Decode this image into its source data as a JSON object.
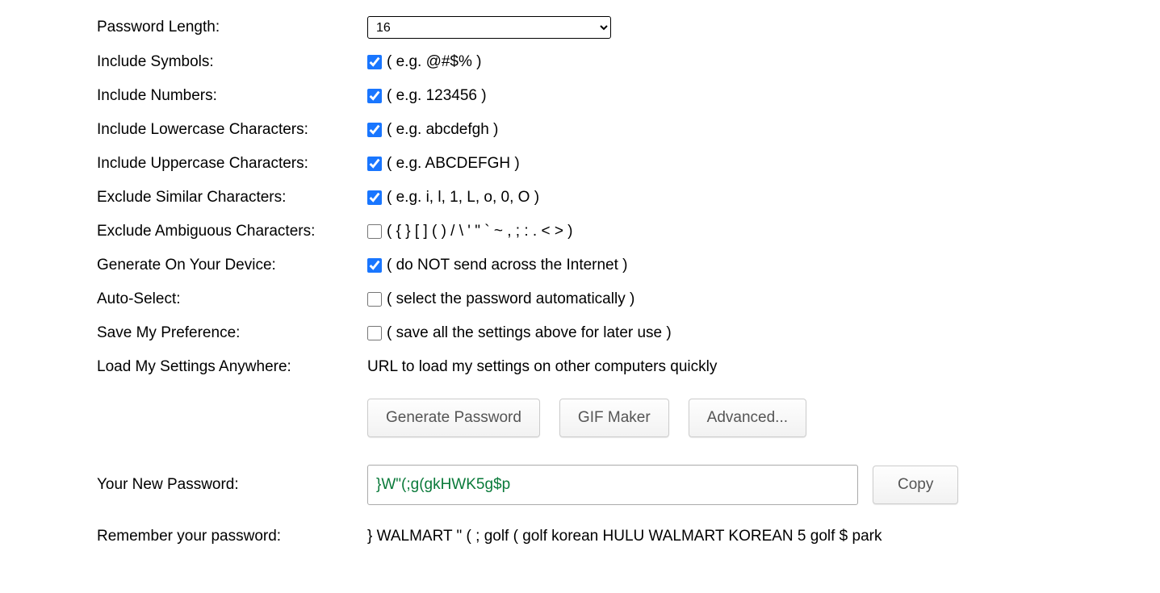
{
  "form": {
    "password_length": {
      "label": "Password Length:",
      "value": "16"
    },
    "include_symbols": {
      "label": "Include Symbols:",
      "checked": true,
      "hint": "( e.g. @#$% )"
    },
    "include_numbers": {
      "label": "Include Numbers:",
      "checked": true,
      "hint": "( e.g. 123456 )"
    },
    "include_lowercase": {
      "label": "Include Lowercase Characters:",
      "checked": true,
      "hint": "( e.g. abcdefgh )"
    },
    "include_uppercase": {
      "label": "Include Uppercase Characters:",
      "checked": true,
      "hint": "( e.g. ABCDEFGH )"
    },
    "exclude_similar": {
      "label": "Exclude Similar Characters:",
      "checked": true,
      "hint": "( e.g. i, l, 1, L, o, 0, O )"
    },
    "exclude_ambiguous": {
      "label": "Exclude Ambiguous Characters:",
      "checked": false,
      "hint": "( { } [ ] ( ) / \\ ' \" ` ~ , ; : . < > )"
    },
    "generate_on_device": {
      "label": "Generate On Your Device:",
      "checked": true,
      "hint": "( do NOT send across the Internet )"
    },
    "auto_select": {
      "label": "Auto-Select:",
      "checked": false,
      "hint": "( select the password automatically )"
    },
    "save_preference": {
      "label": "Save My Preference:",
      "checked": false,
      "hint": "( save all the settings above for later use )"
    },
    "load_settings": {
      "label": "Load My Settings Anywhere:",
      "text": "URL to load my settings on other computers quickly"
    }
  },
  "buttons": {
    "generate": "Generate Password",
    "gif_maker": "GIF Maker",
    "advanced": "Advanced...",
    "copy": "Copy"
  },
  "result": {
    "label": "Your New Password:",
    "value": "}W\"(;g(gkHWK5g$p"
  },
  "mnemonic": {
    "label": "Remember your password:",
    "text": "} WALMART \" ( ; golf ( golf korean HULU WALMART KOREAN 5 golf $ park"
  }
}
